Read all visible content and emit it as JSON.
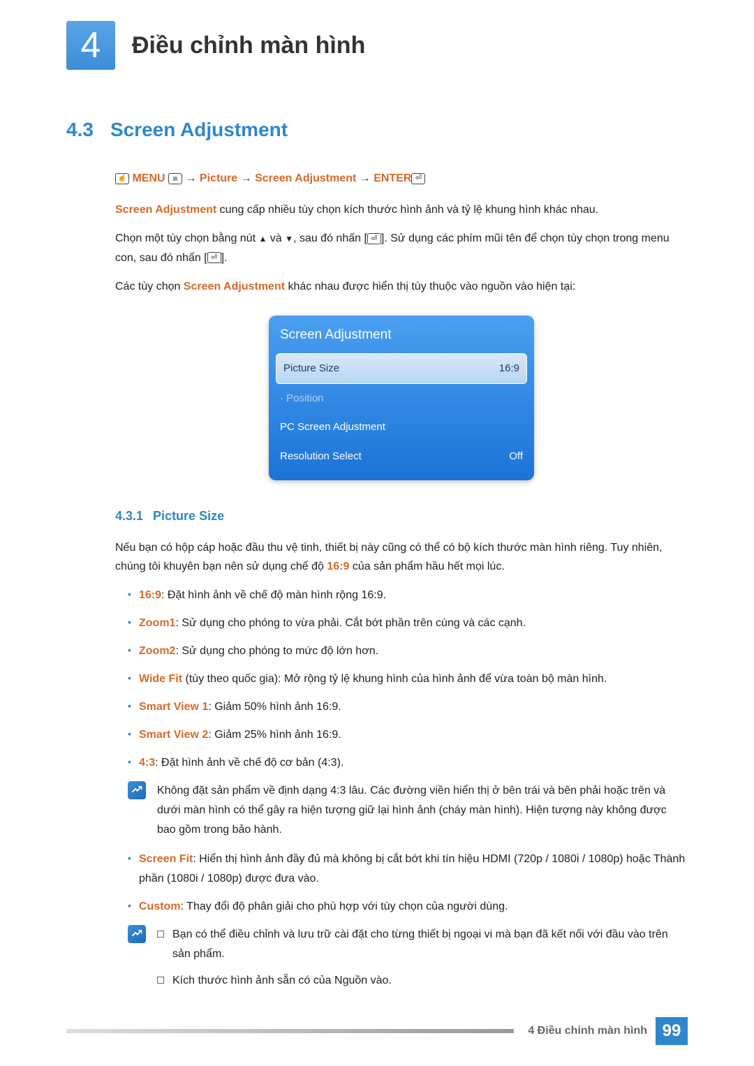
{
  "chapter": {
    "number": "4",
    "title": "Điều chỉnh màn hình"
  },
  "section": {
    "number": "4.3",
    "title": "Screen Adjustment"
  },
  "nav": {
    "menu": "MENU",
    "picture": "Picture",
    "screen_adj": "Screen Adjustment",
    "enter": "ENTER",
    "arrow": "→"
  },
  "para1a": "Screen Adjustment",
  "para1b": " cung cấp nhiều tùy chọn kích thước hình ảnh và tỷ lệ khung hình khác nhau.",
  "para2a": "Chọn một tùy chọn bằng nút ",
  "para2b": " và ",
  "para2c": ", sau đó nhấn [",
  "para2d": "]. Sử dụng các phím mũi tên để chọn tùy chọn trong menu con, sau đó nhấn [",
  "para2e": "].",
  "para3a": "Các tùy chọn ",
  "para3b": "Screen Adjustment",
  "para3c": " khác nhau được hiển thị tùy thuộc vào nguồn vào hiện tại:",
  "osd": {
    "title": "Screen Adjustment",
    "rows": [
      {
        "label": "Picture Size",
        "value": "16:9",
        "selected": true
      },
      {
        "label": "· Position",
        "value": "",
        "dim": true
      },
      {
        "label": "PC Screen Adjustment",
        "value": ""
      },
      {
        "label": "Resolution Select",
        "value": "Off"
      }
    ]
  },
  "subsection": {
    "number": "4.3.1",
    "title": "Picture Size"
  },
  "ps_intro_a": "Nếu bạn có hộp cáp hoặc đầu thu vệ tinh, thiết bị này cũng có thể có bộ kích thước màn hình riêng. Tuy nhiên, chúng tôi khuyên bạn nên sử dụng chế độ ",
  "ps_intro_em": "16:9",
  "ps_intro_b": " của sản phẩm hầu hết mọi lúc.",
  "bullets": [
    {
      "em": "16:9",
      "text": ": Đặt hình ảnh về chế độ màn hình rộng 16:9."
    },
    {
      "em": "Zoom1",
      "text": ": Sử dụng cho phóng to vừa phải. Cắt bớt phần trên cùng và các cạnh."
    },
    {
      "em": "Zoom2",
      "text": ": Sử dụng cho phóng to mức độ lớn hơn."
    },
    {
      "em": "Wide Fit",
      "text": " (tùy theo quốc gia): Mở rộng tỷ lệ khung hình của hình ảnh để vừa toàn bộ màn hình."
    },
    {
      "em": "Smart View 1",
      "text": ": Giảm 50% hình ảnh 16:9."
    },
    {
      "em": "Smart View 2",
      "text": ": Giảm 25% hình ảnh 16:9."
    },
    {
      "em": "4:3",
      "text": ": Đặt hình ảnh về chế độ cơ bản (4:3)."
    }
  ],
  "note43": "Không đặt sản phẩm về định dạng 4:3 lâu. Các đường viền hiển thị ở bên trái và bên phải hoặc trên và dưới màn hình có thể gây ra hiện tượng giữ lại hình ảnh (cháy màn hình). Hiện tượng này không được bao gồm trong bảo hành.",
  "bullets2": [
    {
      "em": "Screen Fit",
      "text": ": Hiển thị hình ảnh đầy đủ mà không bị cắt bớt khi tín hiệu HDMI (720p / 1080i / 1080p) hoặc Thành phần (1080i / 1080p) được đưa vào."
    },
    {
      "em": "Custom",
      "text": ": Thay đổi độ phân giải cho phù hợp với tùy chọn của người dùng."
    }
  ],
  "note_custom": [
    "Bạn có thể điều chỉnh và lưu trữ cài đặt cho từng thiết bị ngoại vi mà bạn đã kết nối với đầu vào trên sản phẩm.",
    "Kích thước hình ảnh sẵn có của Nguồn vào."
  ],
  "footer": {
    "label": "4 Điều chỉnh màn hình",
    "page": "99"
  }
}
